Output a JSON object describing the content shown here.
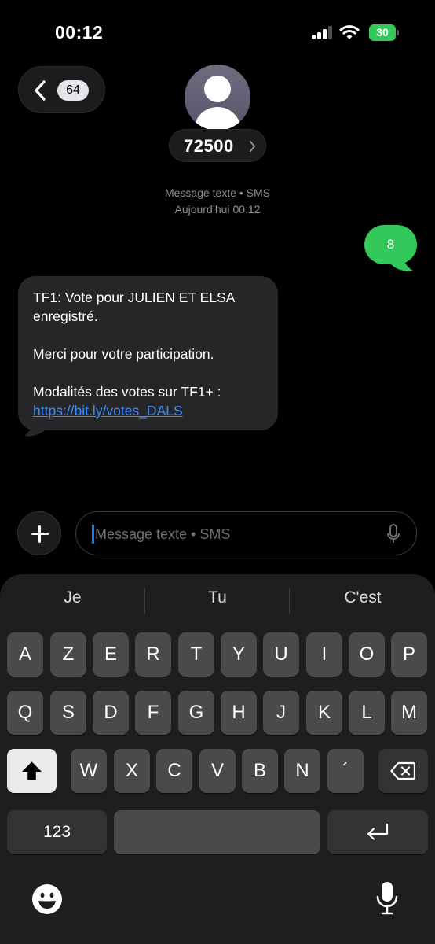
{
  "status_bar": {
    "time": "00:12",
    "battery": "30",
    "battery_color": "#34c759",
    "icons": [
      "cellular-signal-icon",
      "wifi-icon",
      "battery-charging-icon"
    ]
  },
  "header": {
    "back_badge": "64",
    "contact": "72500",
    "icons": [
      "chevron-left-icon",
      "person-avatar-icon",
      "chevron-right-icon"
    ]
  },
  "thread": {
    "meta_line1": "Message texte • SMS",
    "meta_line2": "Aujourd’hui 00:12",
    "sent": "8",
    "received": {
      "line1": "TF1: Vote pour JULIEN ET ELSA enregistré.",
      "line2": "Merci pour votre participation.",
      "line3": "Modalités des votes sur TF1+ :",
      "link": "https://bit.ly/votes_DALS"
    },
    "colors": {
      "sent": "#34c759",
      "received": "#262628",
      "link": "#3b8cff"
    }
  },
  "composer": {
    "placeholder": "Message texte • SMS",
    "icons": [
      "plus-icon",
      "microphone-icon"
    ]
  },
  "keyboard": {
    "suggestions": [
      "Je",
      "Tu",
      "C'est"
    ],
    "row1": [
      "A",
      "Z",
      "E",
      "R",
      "T",
      "Y",
      "U",
      "I",
      "O",
      "P"
    ],
    "row2": [
      "Q",
      "S",
      "D",
      "F",
      "G",
      "H",
      "J",
      "K",
      "L",
      "M"
    ],
    "row3": [
      "W",
      "X",
      "C",
      "V",
      "B",
      "N",
      "´"
    ],
    "numbers_label": "123",
    "icons": [
      "shift-icon",
      "delete-icon",
      "return-icon",
      "emoji-icon",
      "dictation-icon"
    ]
  }
}
